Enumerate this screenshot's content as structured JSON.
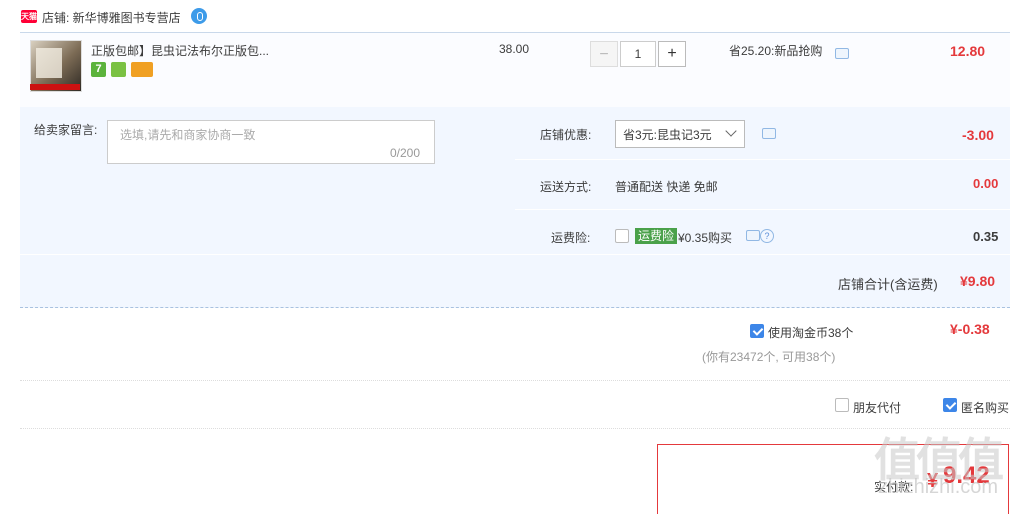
{
  "shop": {
    "badge": "天猫",
    "name": "店铺: 新华博雅图书专营店"
  },
  "item": {
    "title": "正版包邮】昆虫记法布尔正版包...",
    "service_icons": [
      "seven-day-return-icon",
      "android-icon",
      "card-icon"
    ],
    "service_icon_text": "7",
    "unit_price": "38.00",
    "quantity": "1",
    "qty_minus": "−",
    "qty_plus": "+",
    "promotion": "省25.20:新品抢购",
    "subtotal": "12.80"
  },
  "options": {
    "message_label": "给卖家留言:",
    "message_placeholder": "选填,请先和商家协商一致",
    "message_counter": "0/200",
    "shop_discount_label": "店铺优惠:",
    "shop_discount_selected": "省3元:昆虫记3元",
    "shop_discount_value": "-3.00",
    "shipping_label": "运送方式:",
    "shipping_method": "普通配送 快递 免邮",
    "shipping_value": "0.00",
    "insurance_label": "运费险:",
    "insurance_badge": "运费险",
    "insurance_price": "¥0.35购买",
    "insurance_help": "?",
    "insurance_value": "0.35",
    "shop_total_label": "店铺合计(含运费)",
    "shop_total_value": "¥9.80"
  },
  "coins": {
    "label": "使用淘金币38个",
    "checked": true,
    "note": "(你有23472个, 可用38个)",
    "value": "¥-0.38"
  },
  "extras": {
    "friend_pay_label": "朋友代付",
    "friend_pay_checked": false,
    "anonymous_label": "匿名购买",
    "anonymous_checked": true
  },
  "final": {
    "label": "实付款:",
    "currency": "¥",
    "amount": "9.42"
  },
  "watermark": {
    "logo": "值值值",
    "url": "zhizhizhi.com"
  },
  "colors": {
    "accent_red": "#e4393c",
    "panel_bg": "#f2f7ff",
    "check_blue": "#3d86e8",
    "tmall_red": "#ff0036"
  }
}
